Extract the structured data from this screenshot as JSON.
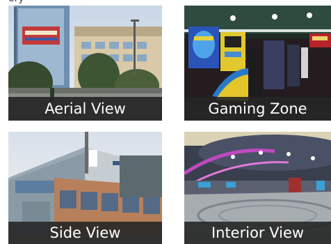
{
  "header": {
    "partial_text": "ery"
  },
  "gallery": {
    "tiles": [
      {
        "caption": "Aerial View"
      },
      {
        "caption": "Gaming Zone"
      },
      {
        "caption": "Side View"
      },
      {
        "caption": "Interior View"
      }
    ]
  },
  "colors": {
    "caption_bg": "#262626",
    "caption_text": "#ffffff"
  }
}
